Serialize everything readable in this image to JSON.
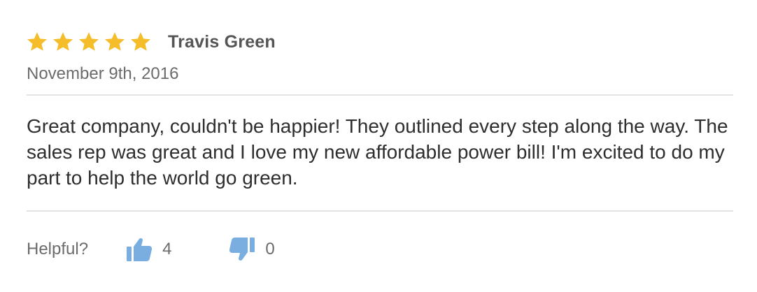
{
  "review": {
    "rating": 5,
    "rating_max": 5,
    "star_color": "#f6bd2b",
    "reviewer_name": "Travis Green",
    "date": "November 9th, 2016",
    "body": "Great company, couldn't be happier! They outlined every step along the way. The sales rep was great and I love my new affordable power bill! I'm excited to do my part to help the world go green."
  },
  "feedback": {
    "label": "Helpful?",
    "upvote_icon": "thumbs-up-icon",
    "upvote_count": "4",
    "downvote_icon": "thumbs-down-icon",
    "downvote_count": "0",
    "icon_color": "#7aaee0"
  }
}
